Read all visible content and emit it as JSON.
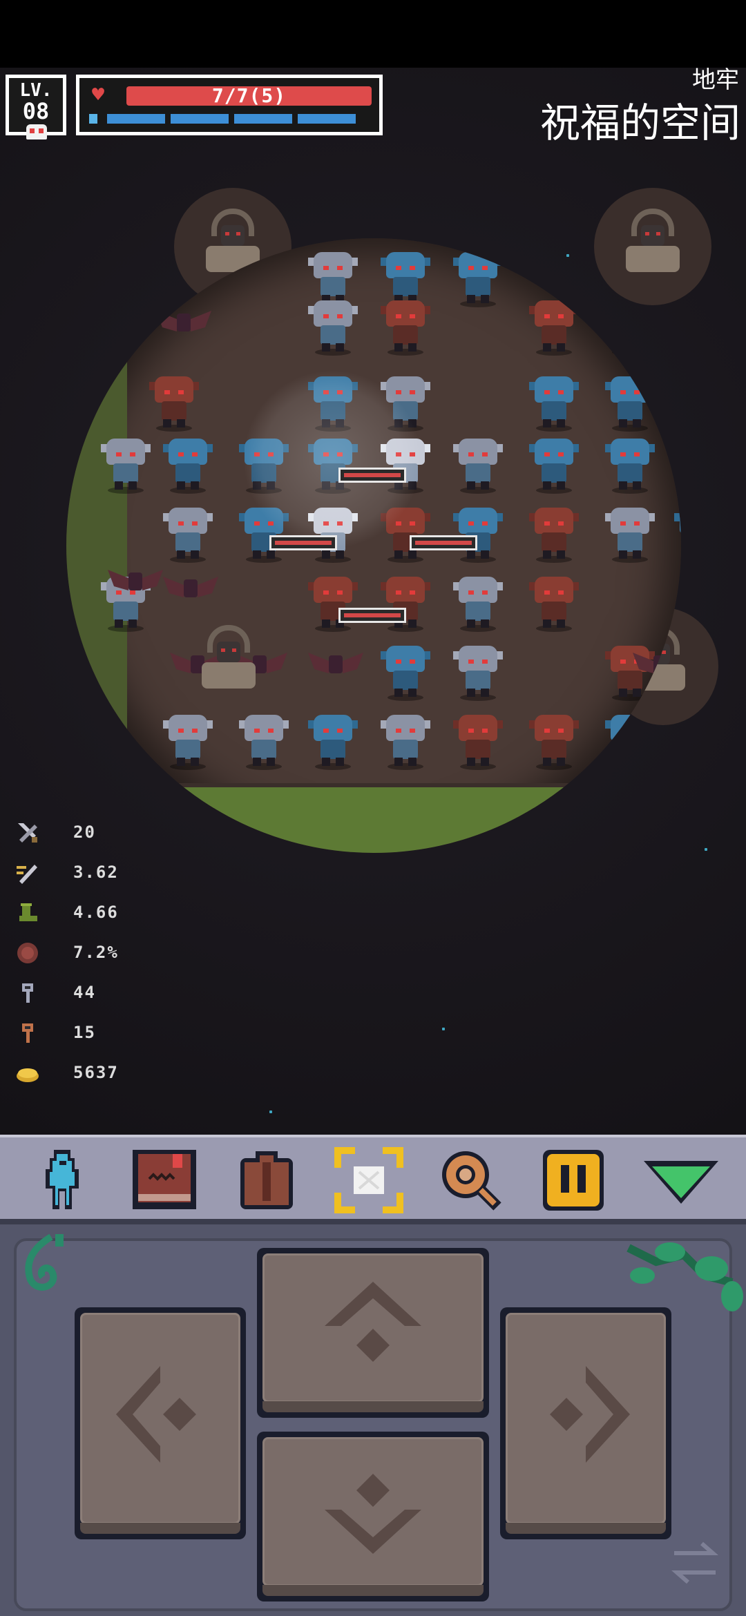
{
  "hud": {
    "level_label": "LV.",
    "level_value": "08",
    "hp_text": "7/7(5)",
    "location_region": "地牢",
    "location_name": "祝福的空间"
  },
  "stats": [
    {
      "icon": "sword-icon",
      "value": "20"
    },
    {
      "icon": "attack-speed-icon",
      "value": "3.62"
    },
    {
      "icon": "boot-icon",
      "value": "4.66"
    },
    {
      "icon": "shield-icon",
      "value": "7.2%"
    },
    {
      "icon": "silver-key-icon",
      "value": "44"
    },
    {
      "icon": "bronze-key-icon",
      "value": "15"
    },
    {
      "icon": "gold-coin-icon",
      "value": "5637"
    }
  ],
  "toolbar": {
    "items": [
      "character-icon",
      "spellbook-icon",
      "backpack-icon",
      "map-focus-icon",
      "search-icon",
      "pause-icon",
      "collapse-icon"
    ]
  },
  "colors": {
    "hp": "#de4b4b",
    "mp": "#3d8fd6",
    "toolbar_bg": "#9b9bb1",
    "pad_bg": "#54566a",
    "dpad_face": "#7a6c68"
  }
}
